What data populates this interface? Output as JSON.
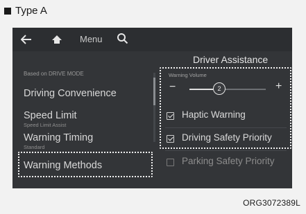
{
  "type_label": "Type A",
  "topbar": {
    "menu_label": "Menu"
  },
  "left": {
    "based_on": "Based on DRIVE MODE",
    "items": [
      {
        "label": "Driving Convenience",
        "sub": ""
      },
      {
        "label": "Speed Limit",
        "sub": "Speed Limit Assist"
      },
      {
        "label": "Warning Timing",
        "sub": "Standard"
      },
      {
        "label": "Warning Methods",
        "sub": ""
      }
    ]
  },
  "right": {
    "title": "Driver Assistance",
    "volume": {
      "label": "Warning Volume",
      "value": "2",
      "minus": "−",
      "plus": "+",
      "level": 0.33
    },
    "options": [
      {
        "label": "Haptic Warning",
        "checked": true
      },
      {
        "label": "Driving Safety Priority",
        "checked": true
      },
      {
        "label": "Parking Safety Priority",
        "checked": false
      }
    ]
  },
  "figure_code": "ORG3072389L"
}
